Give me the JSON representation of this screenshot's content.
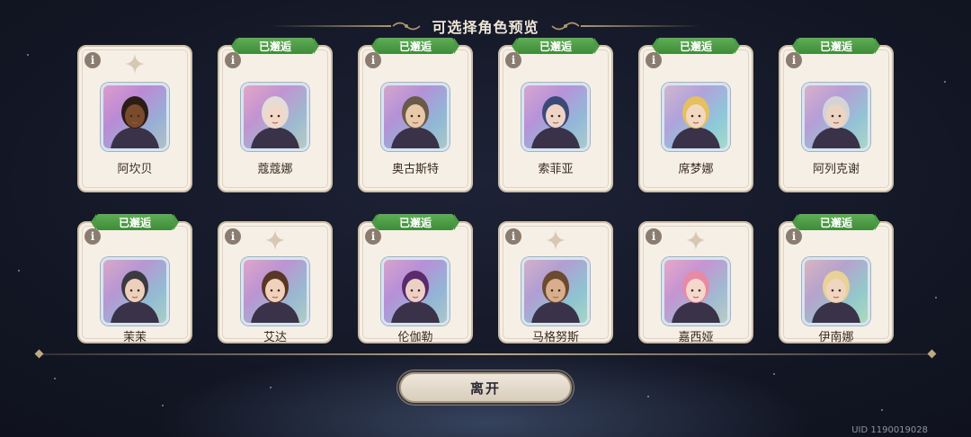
{
  "header": {
    "title": "可选择角色预览"
  },
  "badge_label": "已邂逅",
  "info_label": "i",
  "characters": [
    {
      "name": "阿坎贝",
      "met": false,
      "palette": {
        "skin": "#7a4a2c",
        "hair": "#2b1d16",
        "bg": "#c58ad0"
      }
    },
    {
      "name": "蔻蔻娜",
      "met": true,
      "palette": {
        "skin": "#f2d8c8",
        "hair": "#e4dcd6",
        "bg": "#d8a5c5"
      }
    },
    {
      "name": "奥古斯特",
      "met": true,
      "palette": {
        "skin": "#e8c9a8",
        "hair": "#6a5a48",
        "bg": "#b0a0d8"
      }
    },
    {
      "name": "索菲亚",
      "met": true,
      "palette": {
        "skin": "#efd4c6",
        "hair": "#3c4a78",
        "bg": "#b7a3dc"
      }
    },
    {
      "name": "席梦娜",
      "met": true,
      "palette": {
        "skin": "#f2d8c0",
        "hair": "#e4c060",
        "bg": "#a7d0e0"
      }
    },
    {
      "name": "阿列克谢",
      "met": true,
      "palette": {
        "skin": "#ecd4c2",
        "hair": "#d4d4d8",
        "bg": "#b8c4d4"
      }
    },
    {
      "name": "茉茉",
      "met": true,
      "palette": {
        "skin": "#ecd0bc",
        "hair": "#3a3a40",
        "bg": "#b6b0cc"
      }
    },
    {
      "name": "艾达",
      "met": false,
      "palette": {
        "skin": "#f0d2bc",
        "hair": "#5a3626",
        "bg": "#c8a6c8"
      }
    },
    {
      "name": "伦伽勒",
      "met": true,
      "palette": {
        "skin": "#ecd0c6",
        "hair": "#5a2a6a",
        "bg": "#b79ad8"
      }
    },
    {
      "name": "马格努斯",
      "met": false,
      "palette": {
        "skin": "#d8ae8c",
        "hair": "#6a4a30",
        "bg": "#a8c4cc"
      }
    },
    {
      "name": "嘉西娅",
      "met": false,
      "palette": {
        "skin": "#f4d8cc",
        "hair": "#e88aa6",
        "bg": "#e0a8c8"
      }
    },
    {
      "name": "伊南娜",
      "met": true,
      "palette": {
        "skin": "#f0d6c0",
        "hair": "#e8d296",
        "bg": "#b6d2b8"
      }
    }
  ],
  "footer": {
    "exit_label": "离开",
    "uid": "UID 1190019028"
  },
  "colors": {
    "badge_green": "#4c9a45",
    "card_bg": "#f6efe6",
    "gold_accent": "#b0966a"
  }
}
